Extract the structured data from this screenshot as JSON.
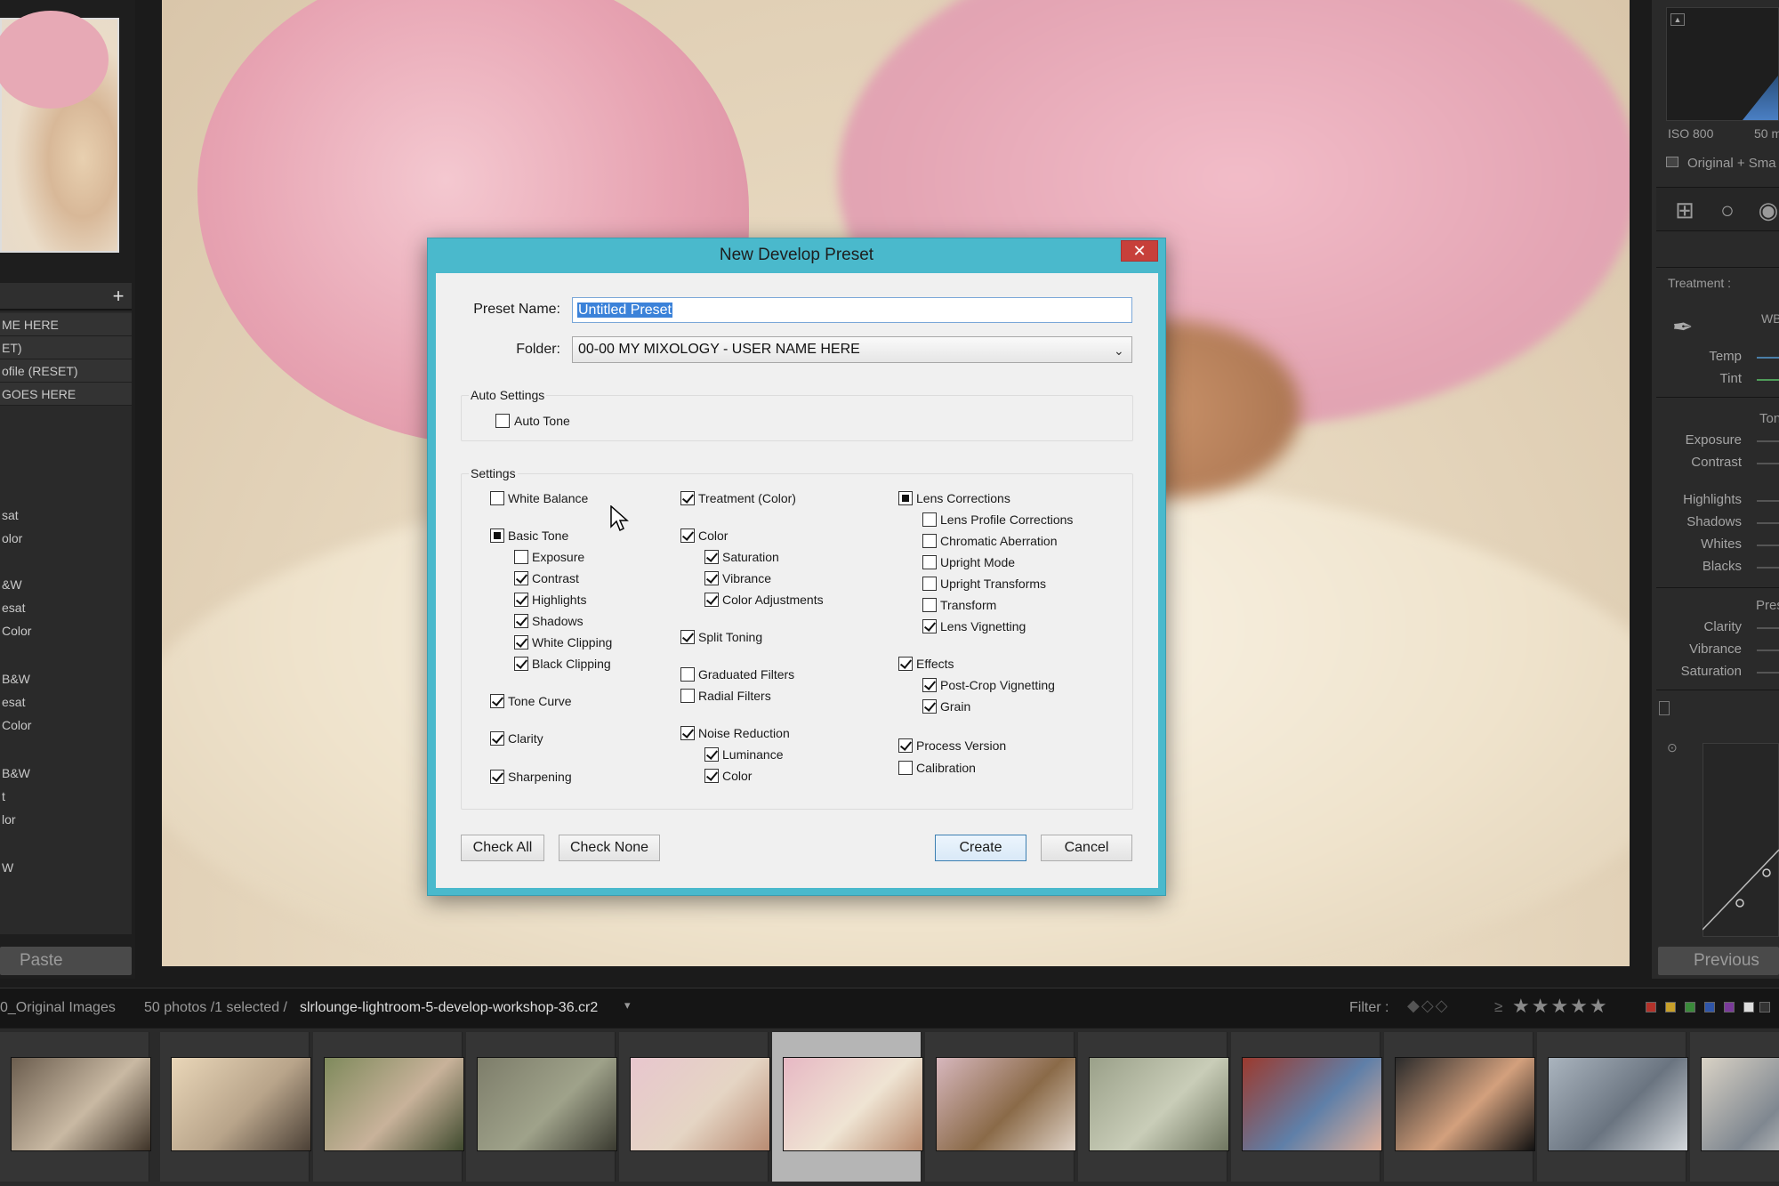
{
  "left_panel": {
    "presets": [
      {
        "label": "ME HERE",
        "boxed": true
      },
      {
        "label": "ET)",
        "boxed": true
      },
      {
        "label": "ofile (RESET)",
        "boxed": true
      },
      {
        "label": "GOES HERE",
        "boxed": true
      },
      {
        "label": "sat",
        "boxed": false
      },
      {
        "label": "olor",
        "boxed": false
      },
      {
        "label": "&W",
        "boxed": false
      },
      {
        "label": "esat",
        "boxed": false
      },
      {
        "label": "Color",
        "boxed": false
      },
      {
        "label": "B&W",
        "boxed": false
      },
      {
        "label": "esat",
        "boxed": false
      },
      {
        "label": " Color",
        "boxed": false
      },
      {
        "label": " B&W",
        "boxed": false
      },
      {
        "label": "t",
        "boxed": false
      },
      {
        "label": "lor",
        "boxed": false
      },
      {
        "label": "W",
        "boxed": false
      }
    ],
    "add_icon": "+",
    "paste_label": "Paste"
  },
  "right_panel": {
    "iso": "ISO 800",
    "focal": "50 m",
    "original_label": "Original + Sma",
    "treatment_label": "Treatment :",
    "wb_label": "WB",
    "temp_label": "Temp",
    "tint_label": "Tint",
    "tone_label": "Ton",
    "exposure_label": "Exposure",
    "contrast_label": "Contrast",
    "highlights_label": "Highlights",
    "shadows_label": "Shadows",
    "whites_label": "Whites",
    "blacks_label": "Blacks",
    "presence_label": "Pres",
    "clarity_label": "Clarity",
    "vibrance_label": "Vibrance",
    "saturation_label": "Saturation",
    "previous_label": "Previous"
  },
  "filmstrip_bar": {
    "source": "0_Original Images",
    "count": "50 photos /1 selected /",
    "filename": "slrlounge-lightroom-5-develop-workshop-36.cr2",
    "caret": "▾",
    "filter_label": "Filter :",
    "flags": "◆◇◇",
    "gte": "≥",
    "stars": "★★★★★"
  },
  "filmstrip": {
    "thumbs": [
      {
        "name": "couple-beach-hug",
        "colors": [
          "#6b5d4e",
          "#c9b9a3",
          "#3e3328"
        ]
      },
      {
        "name": "couple-sunset-beach",
        "colors": [
          "#e9d6b8",
          "#b8a48a",
          "#4b4036"
        ]
      },
      {
        "name": "couple-portrait",
        "colors": [
          "#7f8a5c",
          "#c8b29a",
          "#3f4a2e"
        ]
      },
      {
        "name": "couple-field",
        "colors": [
          "#7d7d6a",
          "#9fa28a",
          "#3a3a30"
        ]
      },
      {
        "name": "newborn-pink-hat-1",
        "colors": [
          "#e8c6ce",
          "#e5d5c4",
          "#b88b72"
        ]
      },
      {
        "name": "newborn-pink-hat-2",
        "colors": [
          "#e7b8c4",
          "#efe4d3",
          "#b6876a"
        ]
      },
      {
        "name": "newborn-basket",
        "colors": [
          "#d7b7bd",
          "#8a6a48",
          "#e0d3c7"
        ]
      },
      {
        "name": "couple-foggy-field",
        "colors": [
          "#9aa089",
          "#c9cdb8",
          "#6f7660"
        ]
      },
      {
        "name": "couple-carnival",
        "colors": [
          "#9c3a2e",
          "#5f7fa8",
          "#e0b09a"
        ]
      },
      {
        "name": "man-portrait",
        "colors": [
          "#2b2b2b",
          "#d3a07d",
          "#111111"
        ]
      },
      {
        "name": "motorcycle-street",
        "colors": [
          "#aab4be",
          "#6a7480",
          "#d4d8dc"
        ]
      },
      {
        "name": "newborn-wrap",
        "colors": [
          "#d9d2c5",
          "#7f8790",
          "#f0ece4"
        ]
      }
    ]
  },
  "dialog": {
    "title": "New Develop Preset",
    "close_icon": "✕",
    "preset_name_label": "Preset Name:",
    "preset_name_value": "Untitled Preset",
    "folder_label": "Folder:",
    "folder_value": "00-00 MY MIXOLOGY - USER NAME HERE",
    "auto_settings_label": "Auto Settings",
    "auto_tone_label": "Auto Tone",
    "settings_label": "Settings",
    "col1": {
      "white_balance": "White Balance",
      "basic_tone": "Basic Tone",
      "exposure": "Exposure",
      "contrast": "Contrast",
      "highlights": "Highlights",
      "shadows": "Shadows",
      "white_clipping": "White Clipping",
      "black_clipping": "Black Clipping",
      "tone_curve": "Tone Curve",
      "clarity": "Clarity",
      "sharpening": "Sharpening"
    },
    "col2": {
      "treatment": "Treatment (Color)",
      "color": "Color",
      "saturation": "Saturation",
      "vibrance": "Vibrance",
      "color_adjustments": "Color Adjustments",
      "split_toning": "Split Toning",
      "graduated_filters": "Graduated Filters",
      "radial_filters": "Radial Filters",
      "noise_reduction": "Noise Reduction",
      "luminance": "Luminance",
      "nr_color": "Color"
    },
    "col3": {
      "lens_corrections": "Lens Corrections",
      "lens_profile": "Lens Profile Corrections",
      "chromatic": "Chromatic Aberration",
      "upright_mode": "Upright Mode",
      "upright_transforms": "Upright Transforms",
      "transform": "Transform",
      "lens_vignetting": "Lens Vignetting",
      "effects": "Effects",
      "post_crop": "Post-Crop Vignetting",
      "grain": "Grain",
      "process_version": "Process Version",
      "calibration": "Calibration"
    },
    "check_all_label": "Check All",
    "check_none_label": "Check None",
    "create_label": "Create",
    "cancel_label": "Cancel"
  }
}
